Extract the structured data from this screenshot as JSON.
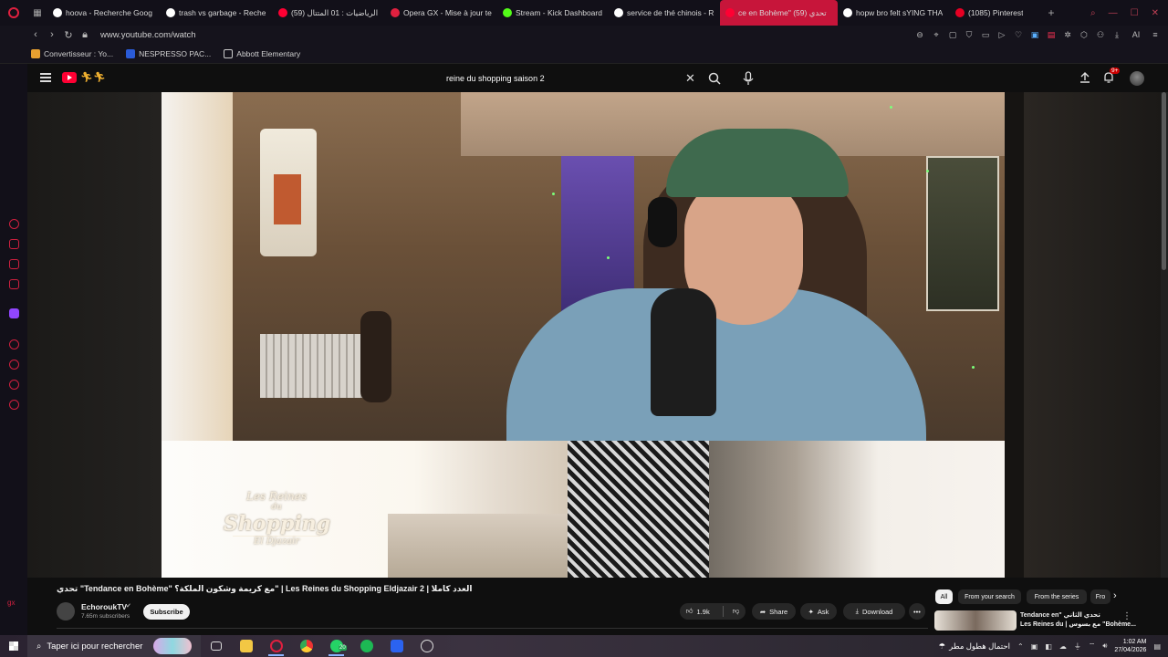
{
  "browser": {
    "tabs": [
      {
        "label": "hoova - Recherche Goog",
        "color": "#ffffff",
        "active": false
      },
      {
        "label": "trash vs garbage - Reche",
        "color": "#ffffff",
        "active": false
      },
      {
        "label": "(59) الرياضيات : 01 المتتال",
        "color": "#ff0033",
        "active": false
      },
      {
        "label": "Opera GX - Mise à jour te",
        "color": "#e0203f",
        "active": false
      },
      {
        "label": "Stream - Kick Dashboard",
        "color": "#53fc18",
        "active": false
      },
      {
        "label": "service de thé chinois - R",
        "color": "#ffffff",
        "active": false
      },
      {
        "label": "ce en Bohème\" تحدي (59)",
        "color": "#ff0033",
        "active": true
      },
      {
        "label": "hopw bro felt sYING THA",
        "color": "#ffffff",
        "active": false
      },
      {
        "label": "(1085) Pinterest",
        "color": "#e60023",
        "active": false
      }
    ],
    "url": "www.youtube.com/watch",
    "bookmarks": [
      {
        "label": "Convertisseur : Yo...",
        "color": "#e8a030"
      },
      {
        "label": "NESPRESSO PAC...",
        "color": "#2a5bd7"
      },
      {
        "label": "Abbott Elementary",
        "color": "#cccccc"
      }
    ],
    "ai_label": "AI"
  },
  "youtube": {
    "search_query": "reine du shopping saison 2",
    "notification_count": "9+",
    "video_title": "تحدي \"Tendance en Bohème\" مع كريمة وشكون الملكة؟\" | Les Reines du Shopping Eldjazair 2 | العدد كاملا",
    "show_logo": {
      "line1": "Les Reines",
      "line2": "du",
      "line3": "Shopping",
      "line4": "El Djazair"
    },
    "channel": {
      "name": "EchoroukTV",
      "verified": "✔",
      "subscribers": "7.65m subscribers"
    },
    "subscribe_label": "Subscribe",
    "actions": {
      "likes": "1.9k",
      "share": "Share",
      "ask": "Ask",
      "download": "Download",
      "more": "•••"
    },
    "chips": [
      "All",
      "From your search",
      "From the series",
      "Fro"
    ],
    "recommendation": {
      "title_line1": "Tendance en\" تحدي الثاني",
      "title_line2": "Les Reines du | مع بسوس \"Bohème..."
    }
  },
  "taskbar": {
    "search_placeholder": "Taper ici pour rechercher",
    "whatsapp_badge": "20",
    "weather": "احتمال هطول مطر",
    "time": "1:02 AM",
    "date": "27/04/2026"
  }
}
